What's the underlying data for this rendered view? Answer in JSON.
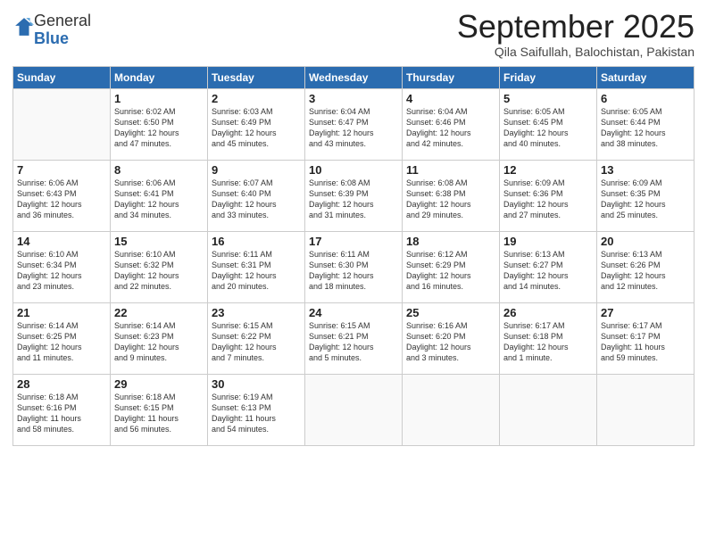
{
  "logo": {
    "general": "General",
    "blue": "Blue"
  },
  "title": "September 2025",
  "subtitle": "Qila Saifullah, Balochistan, Pakistan",
  "days_of_week": [
    "Sunday",
    "Monday",
    "Tuesday",
    "Wednesday",
    "Thursday",
    "Friday",
    "Saturday"
  ],
  "weeks": [
    [
      {
        "day": "",
        "info": ""
      },
      {
        "day": "1",
        "info": "Sunrise: 6:02 AM\nSunset: 6:50 PM\nDaylight: 12 hours\nand 47 minutes."
      },
      {
        "day": "2",
        "info": "Sunrise: 6:03 AM\nSunset: 6:49 PM\nDaylight: 12 hours\nand 45 minutes."
      },
      {
        "day": "3",
        "info": "Sunrise: 6:04 AM\nSunset: 6:47 PM\nDaylight: 12 hours\nand 43 minutes."
      },
      {
        "day": "4",
        "info": "Sunrise: 6:04 AM\nSunset: 6:46 PM\nDaylight: 12 hours\nand 42 minutes."
      },
      {
        "day": "5",
        "info": "Sunrise: 6:05 AM\nSunset: 6:45 PM\nDaylight: 12 hours\nand 40 minutes."
      },
      {
        "day": "6",
        "info": "Sunrise: 6:05 AM\nSunset: 6:44 PM\nDaylight: 12 hours\nand 38 minutes."
      }
    ],
    [
      {
        "day": "7",
        "info": "Sunrise: 6:06 AM\nSunset: 6:43 PM\nDaylight: 12 hours\nand 36 minutes."
      },
      {
        "day": "8",
        "info": "Sunrise: 6:06 AM\nSunset: 6:41 PM\nDaylight: 12 hours\nand 34 minutes."
      },
      {
        "day": "9",
        "info": "Sunrise: 6:07 AM\nSunset: 6:40 PM\nDaylight: 12 hours\nand 33 minutes."
      },
      {
        "day": "10",
        "info": "Sunrise: 6:08 AM\nSunset: 6:39 PM\nDaylight: 12 hours\nand 31 minutes."
      },
      {
        "day": "11",
        "info": "Sunrise: 6:08 AM\nSunset: 6:38 PM\nDaylight: 12 hours\nand 29 minutes."
      },
      {
        "day": "12",
        "info": "Sunrise: 6:09 AM\nSunset: 6:36 PM\nDaylight: 12 hours\nand 27 minutes."
      },
      {
        "day": "13",
        "info": "Sunrise: 6:09 AM\nSunset: 6:35 PM\nDaylight: 12 hours\nand 25 minutes."
      }
    ],
    [
      {
        "day": "14",
        "info": "Sunrise: 6:10 AM\nSunset: 6:34 PM\nDaylight: 12 hours\nand 23 minutes."
      },
      {
        "day": "15",
        "info": "Sunrise: 6:10 AM\nSunset: 6:32 PM\nDaylight: 12 hours\nand 22 minutes."
      },
      {
        "day": "16",
        "info": "Sunrise: 6:11 AM\nSunset: 6:31 PM\nDaylight: 12 hours\nand 20 minutes."
      },
      {
        "day": "17",
        "info": "Sunrise: 6:11 AM\nSunset: 6:30 PM\nDaylight: 12 hours\nand 18 minutes."
      },
      {
        "day": "18",
        "info": "Sunrise: 6:12 AM\nSunset: 6:29 PM\nDaylight: 12 hours\nand 16 minutes."
      },
      {
        "day": "19",
        "info": "Sunrise: 6:13 AM\nSunset: 6:27 PM\nDaylight: 12 hours\nand 14 minutes."
      },
      {
        "day": "20",
        "info": "Sunrise: 6:13 AM\nSunset: 6:26 PM\nDaylight: 12 hours\nand 12 minutes."
      }
    ],
    [
      {
        "day": "21",
        "info": "Sunrise: 6:14 AM\nSunset: 6:25 PM\nDaylight: 12 hours\nand 11 minutes."
      },
      {
        "day": "22",
        "info": "Sunrise: 6:14 AM\nSunset: 6:23 PM\nDaylight: 12 hours\nand 9 minutes."
      },
      {
        "day": "23",
        "info": "Sunrise: 6:15 AM\nSunset: 6:22 PM\nDaylight: 12 hours\nand 7 minutes."
      },
      {
        "day": "24",
        "info": "Sunrise: 6:15 AM\nSunset: 6:21 PM\nDaylight: 12 hours\nand 5 minutes."
      },
      {
        "day": "25",
        "info": "Sunrise: 6:16 AM\nSunset: 6:20 PM\nDaylight: 12 hours\nand 3 minutes."
      },
      {
        "day": "26",
        "info": "Sunrise: 6:17 AM\nSunset: 6:18 PM\nDaylight: 12 hours\nand 1 minute."
      },
      {
        "day": "27",
        "info": "Sunrise: 6:17 AM\nSunset: 6:17 PM\nDaylight: 11 hours\nand 59 minutes."
      }
    ],
    [
      {
        "day": "28",
        "info": "Sunrise: 6:18 AM\nSunset: 6:16 PM\nDaylight: 11 hours\nand 58 minutes."
      },
      {
        "day": "29",
        "info": "Sunrise: 6:18 AM\nSunset: 6:15 PM\nDaylight: 11 hours\nand 56 minutes."
      },
      {
        "day": "30",
        "info": "Sunrise: 6:19 AM\nSunset: 6:13 PM\nDaylight: 11 hours\nand 54 minutes."
      },
      {
        "day": "",
        "info": ""
      },
      {
        "day": "",
        "info": ""
      },
      {
        "day": "",
        "info": ""
      },
      {
        "day": "",
        "info": ""
      }
    ]
  ]
}
